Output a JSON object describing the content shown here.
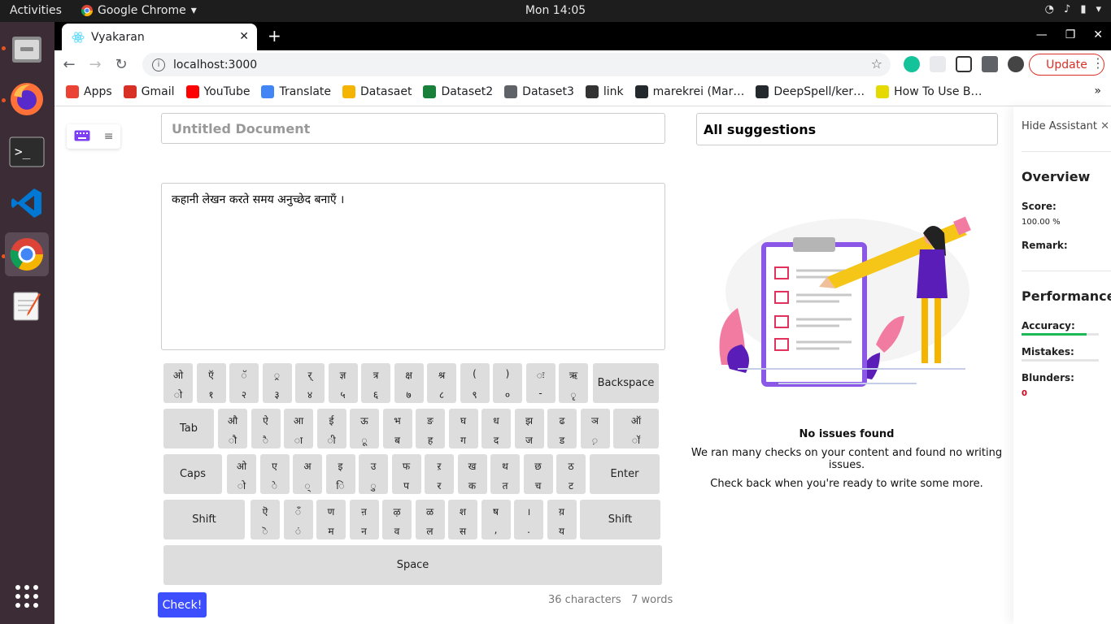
{
  "system": {
    "activities": "Activities",
    "app_name": "Google Chrome",
    "clock": "Mon 14:05"
  },
  "browser": {
    "tab_title": "Vyakaran",
    "url": "localhost:3000",
    "update_label": "Update",
    "bookmarks": [
      {
        "label": "Apps",
        "icon_color": "#ea4335"
      },
      {
        "label": "Gmail",
        "icon_color": "#d93025"
      },
      {
        "label": "YouTube",
        "icon_color": "#ff0000"
      },
      {
        "label": "Translate",
        "icon_color": "#4285f4"
      },
      {
        "label": "Datasaet",
        "icon_color": "#f4b400"
      },
      {
        "label": "Dataset2",
        "icon_color": "#188038"
      },
      {
        "label": "Dataset3",
        "icon_color": "#5f6368"
      },
      {
        "label": "link",
        "icon_color": "#333333"
      },
      {
        "label": "marekrei (Mar…",
        "icon_color": "#24292e"
      },
      {
        "label": "DeepSpell/ker…",
        "icon_color": "#24292e"
      },
      {
        "label": "How To Use B…",
        "icon_color": "#e6d900"
      }
    ]
  },
  "editor": {
    "title_placeholder": "Untitled Document",
    "text": "कहानी लेखन करते समय अनुच्छेद बनाएँ ।",
    "check_label": "Check!",
    "char_count": "36 characters",
    "word_count": "7 words"
  },
  "keyboard": {
    "rows": [
      [
        [
          "ओ",
          "ो"
        ],
        [
          "ऍ",
          "१"
        ],
        [
          "ॅ",
          "२"
        ],
        [
          "्र",
          "३"
        ],
        [
          "र्",
          "४"
        ],
        [
          "ज्ञ",
          "५"
        ],
        [
          "त्र",
          "६"
        ],
        [
          "क्ष",
          "७"
        ],
        [
          "श्र",
          "८"
        ],
        [
          "(",
          "९"
        ],
        [
          ")",
          "०"
        ],
        [
          "ः",
          "-"
        ],
        [
          "ऋ",
          "ृ"
        ]
      ],
      [
        [
          "औ",
          "ौ"
        ],
        [
          "ऐ",
          "ै"
        ],
        [
          "आ",
          "ा"
        ],
        [
          "ई",
          "ी"
        ],
        [
          "ऊ",
          "ू"
        ],
        [
          "भ",
          "ब"
        ],
        [
          "ङ",
          "ह"
        ],
        [
          "घ",
          "ग"
        ],
        [
          "ध",
          "द"
        ],
        [
          "झ",
          "ज"
        ],
        [
          "ढ",
          "ड"
        ],
        [
          "ञ",
          "़"
        ],
        [
          "ऑ",
          "ॉ"
        ]
      ],
      [
        [
          "ओ",
          "ो"
        ],
        [
          "ए",
          "े"
        ],
        [
          "अ",
          "्"
        ],
        [
          "इ",
          "ि"
        ],
        [
          "उ",
          "ु"
        ],
        [
          "फ",
          "प"
        ],
        [
          "ऱ",
          "र"
        ],
        [
          "ख",
          "क"
        ],
        [
          "थ",
          "त"
        ],
        [
          "छ",
          "च"
        ],
        [
          "ठ",
          "ट"
        ]
      ],
      [
        [
          "ऎ",
          "ॆ"
        ],
        [
          "ँ",
          "ं"
        ],
        [
          "ण",
          "म"
        ],
        [
          "ऩ",
          "न"
        ],
        [
          "ऴ",
          "व"
        ],
        [
          "ळ",
          "ल"
        ],
        [
          "श",
          "स"
        ],
        [
          "ष",
          ","
        ],
        [
          "।",
          "."
        ],
        [
          "य़",
          "य"
        ]
      ]
    ],
    "backspace": "Backspace",
    "tab": "Tab",
    "caps": "Caps",
    "enter": "Enter",
    "shift_left": "Shift",
    "shift_right": "Shift",
    "space": "Space"
  },
  "suggestions": {
    "header": "All suggestions",
    "empty_title": "No issues found",
    "empty_line1": "We ran many checks on your content and found no writing issues.",
    "empty_line2": "Check back when you're ready to write some more."
  },
  "assistant": {
    "hide_label": "Hide Assistant",
    "overview": "Overview",
    "score_label": "Score:",
    "score_value": "100.00 %",
    "remark_label": "Remark:",
    "performance": "Performance",
    "accuracy_label": "Accuracy:",
    "accuracy_fraction": 0.84,
    "mistakes_label": "Mistakes:",
    "blunders_label": "Blunders:",
    "blunders_value": "0",
    "accent": "#1db954",
    "blunder_color": "#d0021b"
  }
}
